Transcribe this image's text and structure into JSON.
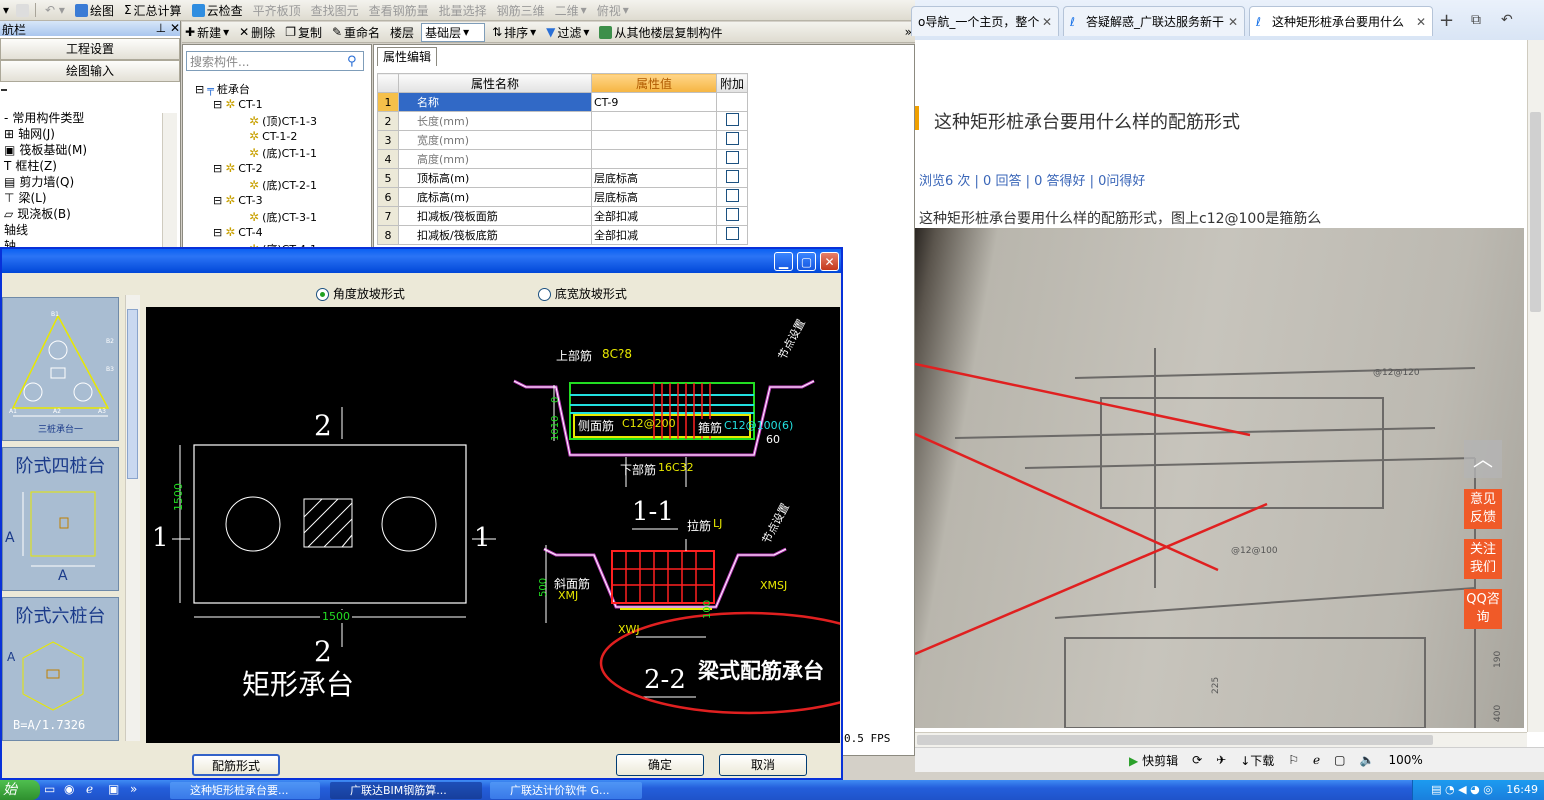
{
  "toolbar1": {
    "items": [
      "绘图",
      "汇总计算",
      "云检查",
      "平齐板顶",
      "查找图元",
      "查看钢筋量",
      "批量选择",
      "钢筋三维",
      "二维",
      "俯视"
    ]
  },
  "nav": {
    "title": "航栏",
    "buttons": [
      "工程设置",
      "绘图输入"
    ],
    "items": [
      "常用构件类型",
      "轴网(J)",
      "筏板基础(M)",
      "框柱(Z)",
      "剪力墙(Q)",
      "梁(L)",
      "现浇板(B)",
      "轴线",
      "轴"
    ]
  },
  "toolbar2": {
    "items": [
      "新建",
      "删除",
      "复制",
      "重命名",
      "楼层",
      "基础层",
      "排序",
      "过滤",
      "从其他楼层复制构件"
    ]
  },
  "tree": {
    "search_placeholder": "搜索构件...",
    "nodes": [
      "桩承台",
      "CT-1",
      "(顶)CT-1-3",
      "CT-1-2",
      "(底)CT-1-1",
      "CT-2",
      "(底)CT-2-1",
      "CT-3",
      "(底)CT-3-1",
      "CT-4",
      "(底)CT-4-1"
    ]
  },
  "props": {
    "tab": "属性编辑",
    "headers": [
      "属性名称",
      "属性值",
      "附加"
    ],
    "rows": [
      {
        "n": "1",
        "name": "名称",
        "value": "CT-9"
      },
      {
        "n": "2",
        "name": "长度(mm)",
        "value": ""
      },
      {
        "n": "3",
        "name": "宽度(mm)",
        "value": ""
      },
      {
        "n": "4",
        "name": "高度(mm)",
        "value": ""
      },
      {
        "n": "5",
        "name": "顶标高(m)",
        "value": "层底标高"
      },
      {
        "n": "6",
        "name": "底标高(m)",
        "value": "层底标高"
      },
      {
        "n": "7",
        "name": "扣减板/筏板面筋",
        "value": "全部扣减"
      },
      {
        "n": "8",
        "name": "扣减板/筏板底筋",
        "value": "全部扣减"
      }
    ],
    "fps": "0.5 FPS"
  },
  "dialog": {
    "radio1": "角度放坡形式",
    "radio2": "底宽放坡形式",
    "btn_rebar": "配筋形式",
    "btn_ok": "确定",
    "btn_cancel": "取消",
    "gallery": [
      {
        "title": "三桩承台一",
        "labels": [
          "B1",
          "B2",
          "B3",
          "A1",
          "A2",
          "A3"
        ]
      },
      {
        "title": "阶式四桩台",
        "labels": [
          "A",
          "A"
        ]
      },
      {
        "title": "阶式六桩台",
        "labels": [
          "A",
          "B=A/1.7326"
        ]
      }
    ]
  },
  "cad": {
    "plan_title": "矩形承台",
    "section_mark": "2",
    "side_mark": "1",
    "dim_h": "1500",
    "dim_v": "1500",
    "sec11": "1-1",
    "sec22": "2-2",
    "beam_note": "梁式配筋承台",
    "top_bar_label": "上部筋",
    "top_bar_val": "8C?8",
    "side_bar_label": "侧面筋",
    "side_bar_val": "C12@200",
    "stirrup_label": "箍筋",
    "stirrup_val": "C12@100(6)",
    "bottom_bar_label": "下部筋",
    "bottom_bar_val": "16C32",
    "tie_label": "拉筋",
    "tie_val": "LJ",
    "slope_label": "斜面筋",
    "slope_val": "XMJ",
    "xmsj": "XMSJ",
    "xwj": "XWJ",
    "angle": "60",
    "dim_1010": "1010",
    "dim_500": "500",
    "dim_100": "100",
    "dim_0": "0",
    "set_note": "节点设置"
  },
  "browser": {
    "tabs": [
      "o导航_一个主页，整个",
      "答疑解惑_广联达服务新干",
      "这种矩形桩承台要用什么"
    ],
    "question_title": "这种矩形桩承台要用什么样的配筋形式",
    "stats": "浏览6 次 | 0 回答 | 0 答得好 | 0问得好",
    "question_body": "这种矩形桩承台要用什么样的配筋形式，图上c12@100是箍筋么",
    "sidebar": [
      "意见反馈",
      "关注我们",
      "QQ咨询"
    ],
    "photo_notes": [
      "@12@120",
      "@12@100",
      "225",
      "400",
      "190"
    ],
    "status": [
      "快剪辑",
      "下载",
      "100%"
    ]
  },
  "taskbar": {
    "start": "始",
    "tasks": [
      "这种矩形桩承台要...",
      "广联达BIM钢筋算...",
      "广联达计价软件 G..."
    ],
    "clock": "16:49"
  }
}
